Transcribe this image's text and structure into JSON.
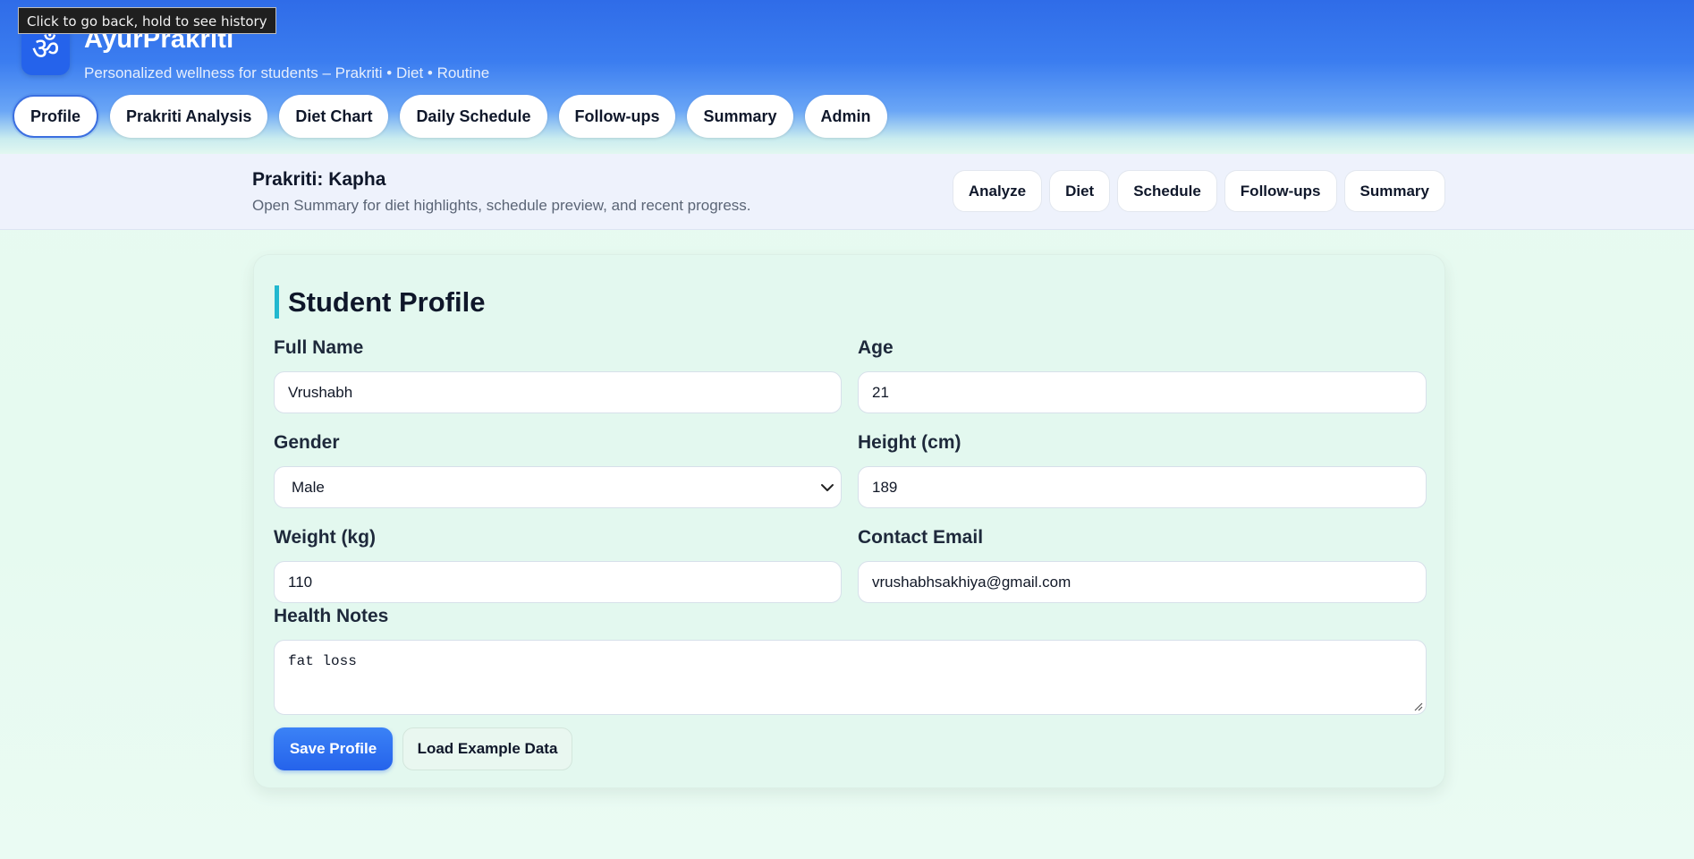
{
  "tooltip": "Click to go back, hold to see history",
  "brand": {
    "logo_glyph": "ॐ",
    "logo_icon": "om-icon",
    "title": "AyurPrakriti",
    "subtitle": "Personalized wellness for students – Prakriti • Diet • Routine"
  },
  "nav": {
    "active": "Profile",
    "items": [
      {
        "label": "Profile"
      },
      {
        "label": "Prakriti Analysis"
      },
      {
        "label": "Diet Chart"
      },
      {
        "label": "Daily Schedule"
      },
      {
        "label": "Follow-ups"
      },
      {
        "label": "Summary"
      },
      {
        "label": "Admin"
      }
    ]
  },
  "status": {
    "title": "Prakriti: Kapha",
    "description": "Open Summary for diet highlights, schedule preview, and recent progress.",
    "quick_links": [
      {
        "label": "Analyze"
      },
      {
        "label": "Diet"
      },
      {
        "label": "Schedule"
      },
      {
        "label": "Follow-ups"
      },
      {
        "label": "Summary"
      }
    ]
  },
  "profile": {
    "title": "Student Profile",
    "full_name": {
      "label": "Full Name",
      "value": "Vrushabh"
    },
    "age": {
      "label": "Age",
      "value": "21"
    },
    "gender": {
      "label": "Gender",
      "value": "Male"
    },
    "height": {
      "label": "Height (cm)",
      "value": "189"
    },
    "weight": {
      "label": "Weight (kg)",
      "value": "110"
    },
    "email": {
      "label": "Contact Email",
      "value": "vrushabhsakhiya@gmail.com"
    },
    "notes": {
      "label": "Health Notes",
      "value": "fat loss"
    },
    "save_label": "Save Profile",
    "example_label": "Load Example Data"
  },
  "colors": {
    "accent": "#2563eb",
    "title_bar": "#22b8cf",
    "card_bg": "#e3f8ef"
  }
}
